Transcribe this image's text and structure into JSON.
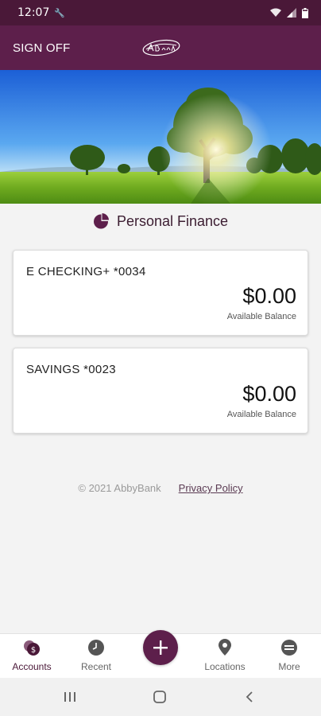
{
  "status_bar": {
    "time": "12:07",
    "icons": [
      "wrench-icon",
      "wifi-icon",
      "signal-icon",
      "battery-icon"
    ]
  },
  "header": {
    "sign_off_label": "SIGN OFF",
    "logo_text": "AbbyBank"
  },
  "section": {
    "title": "Personal Finance",
    "icon": "pie-chart-icon"
  },
  "accounts": [
    {
      "name": "E CHECKING+ *0034",
      "balance": "$0.00",
      "balance_label": "Available Balance"
    },
    {
      "name": "SAVINGS *0023",
      "balance": "$0.00",
      "balance_label": "Available Balance"
    }
  ],
  "footer": {
    "copyright": "© 2021 AbbyBank",
    "privacy_label": "Privacy Policy"
  },
  "tab_bar": {
    "tabs": [
      {
        "label": "Accounts",
        "icon": "accounts-icon",
        "active": true
      },
      {
        "label": "Recent",
        "icon": "clock-icon"
      },
      {
        "label": "Locations",
        "icon": "location-pin-icon"
      },
      {
        "label": "More",
        "icon": "more-icon"
      }
    ],
    "fab_icon": "plus-icon"
  },
  "colors": {
    "brand_dark": "#4a1838",
    "brand": "#5d1f4b",
    "background": "#f3f3f3"
  }
}
